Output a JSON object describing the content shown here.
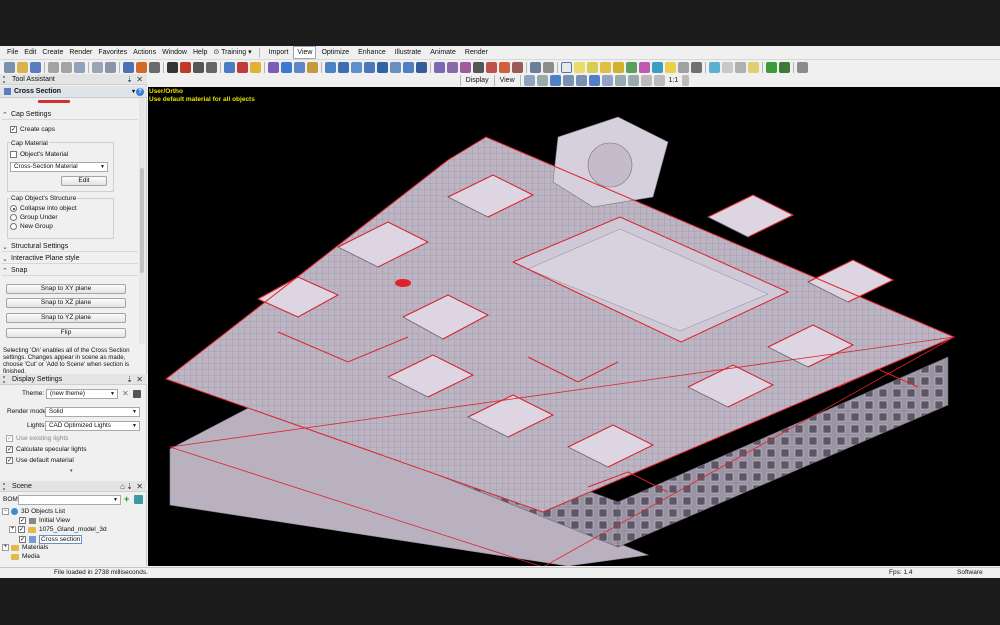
{
  "menubar": {
    "items": [
      "File",
      "Edit",
      "Create",
      "Render",
      "Favorites",
      "Actions",
      "Window",
      "Help",
      "⊙ Training ▾"
    ],
    "ribbon_tabs": [
      "Import",
      "View",
      "Optimize",
      "Enhance",
      "Illustrate",
      "Animate",
      "Render"
    ],
    "active_tab": "View"
  },
  "toolbar2": {
    "display_label": "Display",
    "view_label": "View",
    "scale_label": "1:1"
  },
  "tool_assistant": {
    "header": "Tool Assistant",
    "tool_name": "Cross Section",
    "cap_settings": {
      "label": "Cap Settings",
      "create_caps_label": "Create caps",
      "create_caps_checked": true,
      "cap_material_group": "Cap Material",
      "objects_material_label": "Object's Material",
      "objects_material_checked": false,
      "material_value": "Cross-Section Material",
      "edit_button": "Edit",
      "structure_group": "Cap Object's Structure",
      "structure_options": [
        "Collapse into object",
        "Group Under",
        "New Group"
      ],
      "structure_selected": "Collapse into object"
    },
    "structural_settings_label": "Structural Settings",
    "interactive_plane_label": "Interactive Plane style",
    "snap": {
      "label": "Snap",
      "buttons": [
        "Snap to XY plane",
        "Snap to XZ plane",
        "Snap to YZ plane",
        "Flip"
      ]
    },
    "hint_text": "Selecting 'On' enables all of the Cross Section settings. Changes appear in scene as made, choose 'Cut' or 'Add to Scene' when section is finished."
  },
  "display_settings": {
    "header": "Display Settings",
    "theme_label": "Theme:",
    "theme_value": "(new theme)",
    "render_mode_label": "Render mode:",
    "render_mode_value": "Solid",
    "lights_label": "Lights:",
    "lights_value": "CAD Optimized Lights",
    "use_existing_lights_label": "Use existing lights",
    "use_existing_lights_checked": true,
    "calculate_specular_label": "Calculate specular lights",
    "calculate_specular_checked": true,
    "use_default_material_label": "Use default material",
    "use_default_material_checked": true
  },
  "scene": {
    "header": "Scene",
    "bom_label": "BOM:",
    "tree": [
      {
        "label": "3D Objects List",
        "depth": 0
      },
      {
        "label": "Initial View",
        "depth": 1
      },
      {
        "label": "1075_Gland_model_3d",
        "depth": 1
      },
      {
        "label": "Cross section",
        "depth": 1
      },
      {
        "label": "Materials",
        "depth": 0
      },
      {
        "label": "Media",
        "depth": 0
      }
    ]
  },
  "viewport": {
    "camera_label": "User/Ortho",
    "material_note": "Use default material for all objects"
  },
  "statusbar": {
    "message": "File loaded in 2738 milliseconds.",
    "fps": "Fps: 1.4",
    "renderer": "Software"
  },
  "colors": {
    "section_red": "#e0232b",
    "model_fill": "#c7bfcc",
    "viewport_bg": "#000000",
    "overlay_text": "#e8e000"
  }
}
